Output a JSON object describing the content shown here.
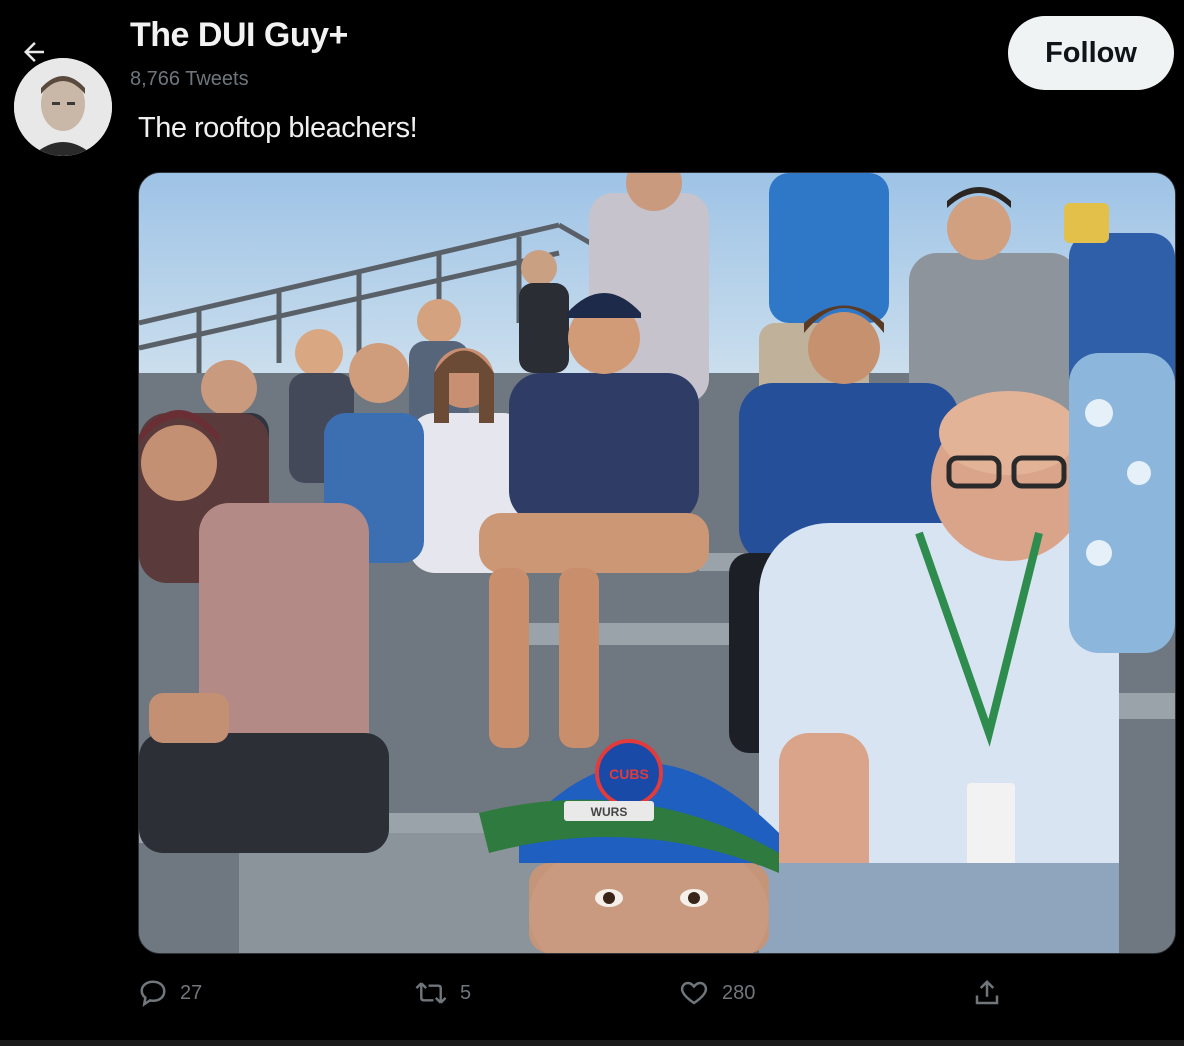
{
  "header": {
    "title": "The DUI Guy+",
    "subtitle": "8,766 Tweets",
    "follow_label": "Follow"
  },
  "tweet": {
    "text": "The rooftop bleachers!"
  },
  "media": {
    "cap_logo_text": "CUBS",
    "cap_label_text": "WURS"
  },
  "actions": {
    "replies": "27",
    "retweets": "5",
    "likes": "280"
  },
  "icons": {
    "back": "arrow-left-icon",
    "reply": "speech-bubble-icon",
    "retweet": "retweet-arrows-icon",
    "like": "heart-icon",
    "share": "share-upload-icon"
  },
  "colors": {
    "background": "#000000",
    "follow_bg": "#eff3f4",
    "muted_text": "#71767b"
  }
}
